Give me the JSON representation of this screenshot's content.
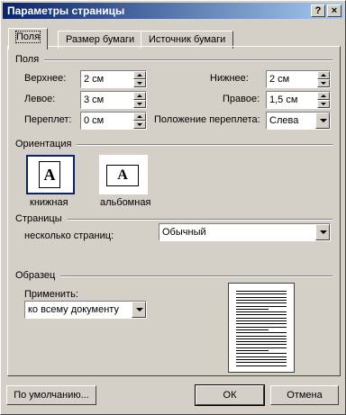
{
  "window": {
    "title": "Параметры страницы",
    "help_glyph": "?",
    "close_glyph": "×"
  },
  "tabs": [
    {
      "label": "Поля"
    },
    {
      "label": "Размер бумаги"
    },
    {
      "label": "Источник бумаги"
    }
  ],
  "margins": {
    "group_label": "Поля",
    "top_label": "Верхнее:",
    "top_value": "2 см",
    "bottom_label": "Нижнее:",
    "bottom_value": "2 см",
    "left_label": "Левое:",
    "left_value": "3 см",
    "right_label": "Правое:",
    "right_value": "1,5 см",
    "gutter_label": "Переплет:",
    "gutter_value": "0 см",
    "gutter_pos_label": "Положение переплета:",
    "gutter_pos_value": "Слева"
  },
  "orientation": {
    "group_label": "Ориентация",
    "portrait_label": "книжная",
    "landscape_label": "альбомная",
    "icon_letter": "A",
    "selected": "portrait"
  },
  "pages": {
    "group_label": "Страницы",
    "multiple_label": "несколько страниц:",
    "multiple_value": "Обычный"
  },
  "sample": {
    "group_label": "Образец",
    "apply_label": "Применить:",
    "apply_value": "ко всему документу"
  },
  "buttons": {
    "default": "По умолчанию...",
    "ok": "ОК",
    "cancel": "Отмена"
  }
}
